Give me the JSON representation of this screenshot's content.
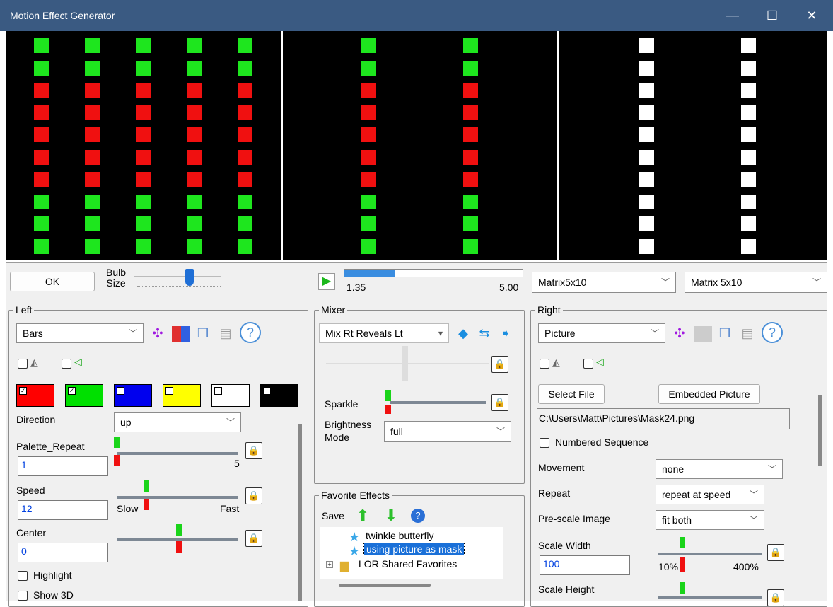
{
  "window": {
    "title": "Motion Effect Generator",
    "minimize": "—",
    "maximize": "☐",
    "close": "✕"
  },
  "preview": {
    "left": {
      "columns": 5,
      "rows": 10,
      "colors": [
        "#1ee61e",
        "#1ee61e",
        "#f01010",
        "#f01010",
        "#f01010",
        "#f01010",
        "#f01010",
        "#1ee61e",
        "#1ee61e",
        "#1ee61e"
      ]
    },
    "mid": {
      "columns": 2,
      "rows": 10,
      "col_colors": [
        [
          "#1ee61e",
          "#1ee61e",
          "#f01010",
          "#f01010",
          "#f01010",
          "#f01010",
          "#f01010",
          "#1ee61e",
          "#1ee61e",
          "#1ee61e"
        ],
        [
          "#1ee61e",
          "#1ee61e",
          "#f01010",
          "#f01010",
          "#f01010",
          "#f01010",
          "#f01010",
          "#1ee61e",
          "#1ee61e",
          "#1ee61e"
        ]
      ]
    },
    "right": {
      "columns": 2,
      "rows": 10,
      "color": "#ffffff"
    }
  },
  "top": {
    "ok": "OK",
    "bulb_size": "Bulb Size",
    "play_icon": "play-icon",
    "progress_current": "1.35",
    "progress_end": "5.00",
    "progress_fraction": 0.28,
    "model_left": "Matrix5x10",
    "model_right": "Matrix 5x10"
  },
  "left": {
    "label": "Left",
    "effect": "Bars",
    "icons": [
      "merge-icon",
      "palette-icon",
      "copy-icon",
      "paste-icon",
      "help-icon"
    ],
    "swatches": [
      {
        "color": "#ff0000",
        "checked": true
      },
      {
        "color": "#00e000",
        "checked": true
      },
      {
        "color": "#0000ee",
        "checked": false
      },
      {
        "color": "#ffff00",
        "checked": false
      },
      {
        "color": "#ffffff",
        "checked": false
      },
      {
        "color": "#000000",
        "checked": false
      }
    ],
    "direction_label": "Direction",
    "direction": "up",
    "palette_repeat_label": "Palette_Repeat",
    "palette_repeat": "1",
    "palette_max": "5",
    "speed_label": "Speed",
    "speed": "12",
    "slow": "Slow",
    "fast": "Fast",
    "center_label": "Center",
    "center": "0",
    "highlight": "Highlight",
    "show3d": "Show 3D"
  },
  "mixer": {
    "label": "Mixer",
    "mode": "Mix Rt Reveals Lt",
    "sparkle": "Sparkle",
    "brightness_label": "Brightness Mode",
    "brightness": "full"
  },
  "favorites": {
    "label": "Favorite Effects",
    "save": "Save",
    "items": [
      "twinkle butterfly",
      "using picture as mask",
      "LOR Shared Favorites"
    ],
    "selected": 1
  },
  "right": {
    "label": "Right",
    "effect": "Picture",
    "select_file": "Select File",
    "embedded": "Embedded Picture",
    "path": "C:\\Users\\Matt\\Pictures\\Mask24.png",
    "numbered": "Numbered Sequence",
    "movement_label": "Movement",
    "movement": "none",
    "repeat_label": "Repeat",
    "repeat": "repeat at speed",
    "prescale_label": "Pre-scale Image",
    "prescale": "fit both",
    "scale_width_label": "Scale Width",
    "scale_width": "100",
    "sw_min": "10%",
    "sw_max": "400%",
    "scale_height_label": "Scale Height"
  }
}
